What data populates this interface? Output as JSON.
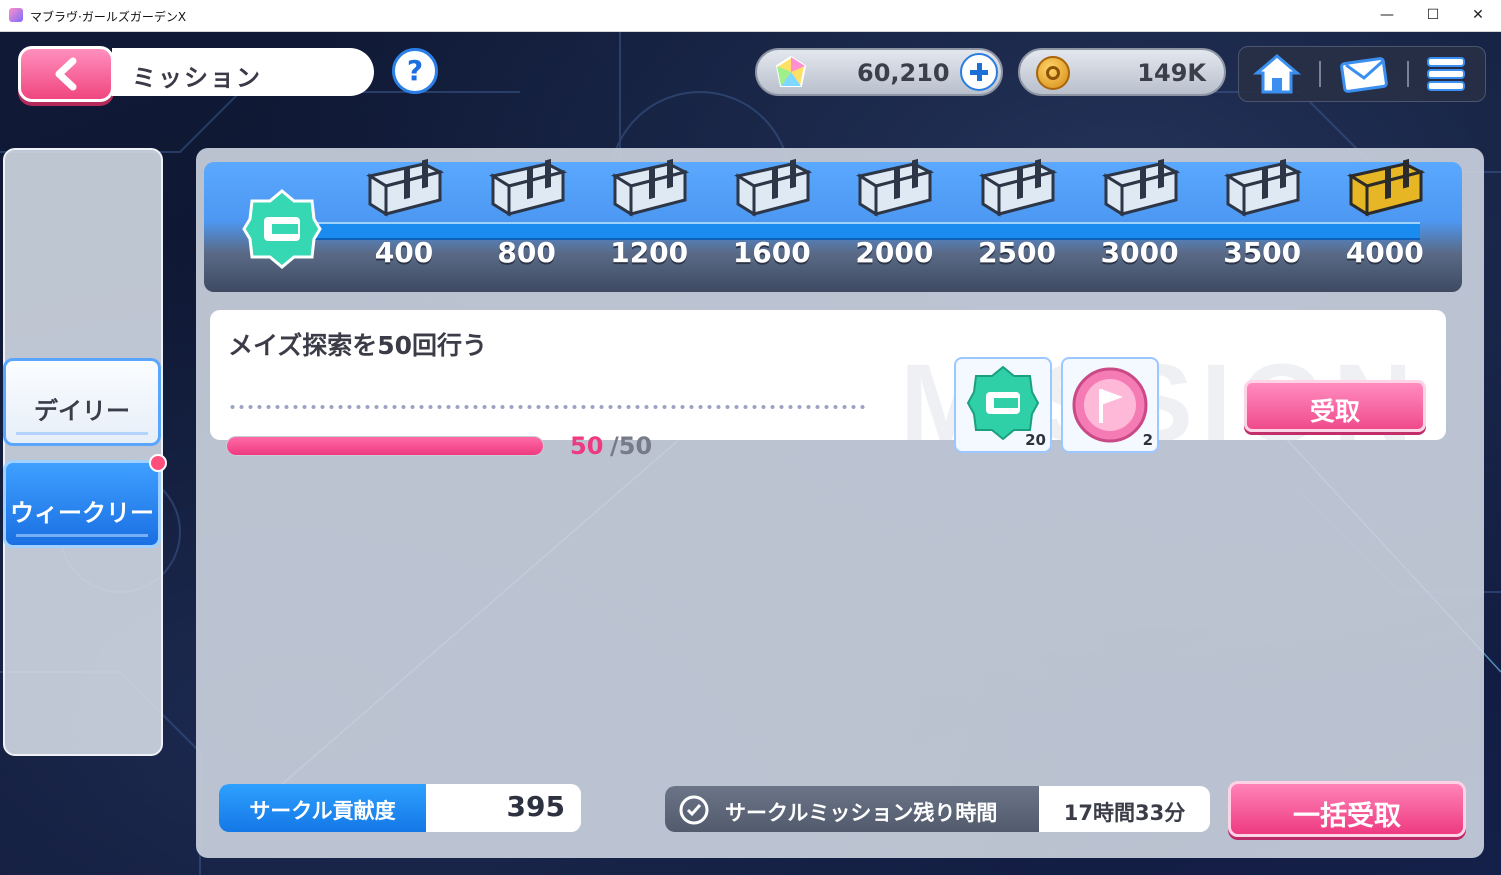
{
  "window": {
    "title": "マブラヴ·ガールズガーデンX",
    "minimize": "—",
    "maximize": "☐",
    "close": "✕"
  },
  "header": {
    "back_icon": "chevron-left-icon",
    "title": "ミッション",
    "help_label": "?",
    "gems": {
      "icon": "gem-icon",
      "value": "60,210",
      "plus_icon": "plus-icon"
    },
    "coins": {
      "icon": "coin-icon",
      "value": "149K"
    },
    "nav": [
      "home-icon",
      "mail-icon",
      "menu-icon"
    ]
  },
  "tabs": [
    {
      "label": "デイリー",
      "selected": false
    },
    {
      "label": "ウィークリー",
      "selected": true,
      "badge": true
    }
  ],
  "milestones": {
    "start_icon": "circle-points-icon",
    "steps": [
      {
        "label": "400",
        "chest": "silver"
      },
      {
        "label": "800",
        "chest": "silver"
      },
      {
        "label": "1200",
        "chest": "silver"
      },
      {
        "label": "1600",
        "chest": "silver"
      },
      {
        "label": "2000",
        "chest": "silver"
      },
      {
        "label": "2500",
        "chest": "silver"
      },
      {
        "label": "3000",
        "chest": "silver"
      },
      {
        "label": "3500",
        "chest": "silver"
      },
      {
        "label": "4000",
        "chest": "gold"
      }
    ]
  },
  "mission": {
    "title": "メイズ探索を50回行う",
    "progress_current": "50",
    "progress_max": "/50",
    "progress_fraction": 1.0,
    "watermark": "MISSION",
    "rewards": [
      {
        "icon": "circle-points-icon",
        "qty": "20"
      },
      {
        "icon": "flag-medal-icon",
        "qty": "2"
      }
    ],
    "claim_label": "受取"
  },
  "footer": {
    "contribution_label": "サークル貢献度",
    "contribution_value": "395",
    "timer_label": "サークルミッション残り時間",
    "timer_value": "17時間33分",
    "bulk_claim_label": "一括受取"
  },
  "colors": {
    "accent_pink": "#ee3a81",
    "accent_blue": "#1478e6",
    "panel": "#cdd4e0"
  }
}
